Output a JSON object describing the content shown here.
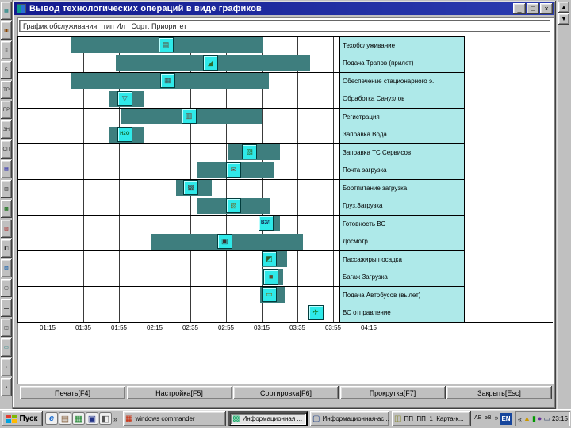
{
  "window": {
    "title": "Вывод технологических операций в виде графиков",
    "controls": {
      "minimize": "_",
      "maximize": "□",
      "close": "×"
    },
    "header_text": "График обслуживания   тип Ил   Сорт: Приоритет",
    "action_buttons": [
      {
        "label": "Печать[F4]"
      },
      {
        "label": "Настройка[F5]"
      },
      {
        "label": "Сортировка[F6]"
      },
      {
        "label": "Прокрутка[F7]"
      },
      {
        "label": "Закрыть[Esc]"
      }
    ]
  },
  "chart_data": {
    "type": "gantt",
    "title": "График обслуживания",
    "x_axis": {
      "tick_labels": [
        "01:15",
        "01:35",
        "01:55",
        "02:15",
        "02:35",
        "02:55",
        "03:15",
        "03:35",
        "03:55",
        "04:15"
      ],
      "minutes_per_division": 20
    },
    "colors": {
      "bar": "#3E7E7E",
      "icon_bg": "#2FE9E9",
      "legend_bg": "#AEE9E9"
    },
    "legend_position": "right",
    "rows": [
      {
        "label": "Техобслуживание",
        "start": "01:28",
        "end": "03:16",
        "start_min": 88,
        "end_min": 196,
        "icon_min": 137,
        "icon": "maintenance-icon",
        "glyph": "▤",
        "glyph_color": "#5a4632"
      },
      {
        "label": "Подача Трапов (прилет)",
        "start": "01:53",
        "end": "03:42",
        "start_min": 113,
        "end_min": 222,
        "icon_min": 162,
        "icon": "gangway-icon",
        "glyph": "◢",
        "glyph_color": "#2f6d2f"
      },
      {
        "label": "Обеспечение стационарного э.",
        "start": "01:28",
        "end": "03:19",
        "start_min": 88,
        "end_min": 199,
        "icon_min": 138,
        "icon": "ground-power-icon",
        "glyph": "▦",
        "glyph_color": "#444444"
      },
      {
        "label": "Обработка Санузлов",
        "start": "01:49",
        "end": "02:09",
        "start_min": 109,
        "end_min": 129,
        "icon_min": 114,
        "icon": "lavatory-service-icon",
        "glyph": "▽",
        "glyph_color": "#555555"
      },
      {
        "label": "Регистрация",
        "start": "01:56",
        "end": "03:15",
        "start_min": 116,
        "end_min": 195,
        "icon_min": 150,
        "icon": "check-in-icon",
        "glyph": "▥",
        "glyph_color": "#6b4a3a"
      },
      {
        "label": "Заправка Вода",
        "start": "01:49",
        "end": "02:09",
        "start_min": 109,
        "end_min": 129,
        "icon_min": 114,
        "icon": "water-service-icon",
        "glyph": "H2O",
        "glyph_color": "#156d3a"
      },
      {
        "label": "Заправка ТС Сервисов",
        "start": "02:56",
        "end": "03:25",
        "start_min": 176,
        "end_min": 205,
        "icon_min": 184,
        "icon": "refueling-icon",
        "glyph": "▧",
        "glyph_color": "#2f6d2f"
      },
      {
        "label": "Почта загрузка",
        "start": "02:39",
        "end": "03:22",
        "start_min": 159,
        "end_min": 202,
        "icon_min": 175,
        "icon": "mail-loading-icon",
        "glyph": "✉",
        "glyph_color": "#7a3b2e"
      },
      {
        "label": "Бортпитание загрузка",
        "start": "02:27",
        "end": "02:47",
        "start_min": 147,
        "end_min": 167,
        "icon_min": 151,
        "icon": "catering-icon",
        "glyph": "▩",
        "glyph_color": "#444444"
      },
      {
        "label": "Груз.Загрузка",
        "start": "02:39",
        "end": "03:20",
        "start_min": 159,
        "end_min": 200,
        "icon_min": 175,
        "icon": "cargo-loading-icon",
        "glyph": "▨",
        "glyph_color": "#6a6a2a"
      },
      {
        "label": "Готовность ВС",
        "start": "03:13",
        "end": "03:25",
        "start_min": 193,
        "end_min": 205,
        "icon_min": 193,
        "icon": "aircraft-ready-icon",
        "glyph": "ВЗЛ",
        "glyph_color": "#101f4a"
      },
      {
        "label": "Досмотр",
        "start": "02:13",
        "end": "03:38",
        "start_min": 133,
        "end_min": 218,
        "icon_min": 170,
        "icon": "security-check-icon",
        "glyph": "▣",
        "glyph_color": "#333333"
      },
      {
        "label": "Пассажиры посадка",
        "start": "03:15",
        "end": "03:29",
        "start_min": 195,
        "end_min": 209,
        "icon_min": 195,
        "icon": "passenger-boarding-icon",
        "glyph": "◩",
        "glyph_color": "#2e5d2e"
      },
      {
        "label": "Багаж Загрузка",
        "start": "03:15",
        "end": "03:27",
        "start_min": 195,
        "end_min": 207,
        "icon_min": 196,
        "icon": "baggage-loading-icon",
        "glyph": "■",
        "glyph_color": "#5d4a2e"
      },
      {
        "label": "Подача Автобусов (вылет)",
        "start": "03:14",
        "end": "03:28",
        "start_min": 194,
        "end_min": 208,
        "icon_min": 195,
        "icon": "bus-departure-icon",
        "glyph": "▭",
        "glyph_color": "#7a6a16"
      },
      {
        "label": "ВС отправление",
        "start": "03:46",
        "end": "03:56",
        "start_min": null,
        "end_min": null,
        "icon_min": 221,
        "icon": "aircraft-departure-icon",
        "glyph": "✈",
        "glyph_color": "#0a6a0a"
      }
    ]
  },
  "left_toolbar": {
    "items": [
      {
        "glyph": "▦",
        "color": "#007a7a"
      },
      {
        "glyph": "▣",
        "color": "#884400"
      },
      {
        "glyph": "≡",
        "color": "#333333"
      },
      {
        "glyph": "Б",
        "color": "#333333"
      },
      {
        "glyph": "ТР",
        "color": "#333333"
      },
      {
        "glyph": "ПР",
        "color": "#333333"
      },
      {
        "glyph": "ЗН",
        "color": "#333333"
      },
      {
        "glyph": "ОП",
        "color": "#333333"
      },
      {
        "glyph": "▤",
        "color": "#0000aa"
      },
      {
        "glyph": "▥",
        "color": "#333333"
      },
      {
        "glyph": "▩",
        "color": "#006600"
      },
      {
        "glyph": "▨",
        "color": "#aa2222"
      },
      {
        "glyph": "◧",
        "color": "#333333"
      },
      {
        "glyph": "▧",
        "color": "#0055aa"
      },
      {
        "glyph": "▢",
        "color": "#333333"
      },
      {
        "glyph": "▬",
        "color": "#555555"
      },
      {
        "glyph": "◫",
        "color": "#333333"
      },
      {
        "glyph": "▭",
        "color": "#007777"
      },
      {
        "glyph": "▫",
        "color": "#333333"
      },
      {
        "glyph": "▪",
        "color": "#333333"
      }
    ]
  },
  "right_scrollbar": {
    "up": "▲",
    "down": "▼"
  },
  "taskbar": {
    "start_label": "Пуск",
    "quick_launch": [
      {
        "name": "ie-icon",
        "glyph": "e",
        "color": "#1b6ed0"
      },
      {
        "name": "mail-icon",
        "glyph": "▤",
        "color": "#886644"
      },
      {
        "name": "explorer-icon",
        "glyph": "▦",
        "color": "#228833"
      },
      {
        "name": "media-icon",
        "glyph": "▣",
        "color": "#223388"
      },
      {
        "name": "viewer-icon",
        "glyph": "◧",
        "color": "#555555"
      }
    ],
    "quick_chevron": "»",
    "tasks": [
      {
        "label": "windows commander",
        "icon": "commander-icon",
        "icon_glyph": "▦",
        "icon_color": "#cc2200",
        "active": false
      },
      {
        "label": "Информационная ...",
        "icon": "info-system-icon",
        "icon_glyph": "▩",
        "icon_color": "#11aa66",
        "active": true
      },
      {
        "label": "Информационная-ас...",
        "icon": "info-window-icon",
        "icon_glyph": "▢",
        "icon_color": "#224488",
        "active": false
      },
      {
        "label": "ПП_ПП_1_Карта-к...",
        "icon": "archive-icon",
        "icon_glyph": "◫",
        "icon_color": "#888833",
        "active": false
      }
    ],
    "deskband": {
      "labels": [
        "АЕ",
        "эВ"
      ],
      "chevron": "»"
    },
    "language": "EN",
    "tray_chevron": "«",
    "tray_icons": [
      {
        "name": "alert-tray-icon",
        "glyph": "▲",
        "color": "#cc9900"
      },
      {
        "name": "antivirus-tray-icon",
        "glyph": "▮",
        "color": "#009900"
      },
      {
        "name": "audio-tray-icon",
        "glyph": "●",
        "color": "#663399"
      },
      {
        "name": "display-tray-icon",
        "glyph": "▭",
        "color": "#334466"
      }
    ],
    "clock": "23:15"
  }
}
